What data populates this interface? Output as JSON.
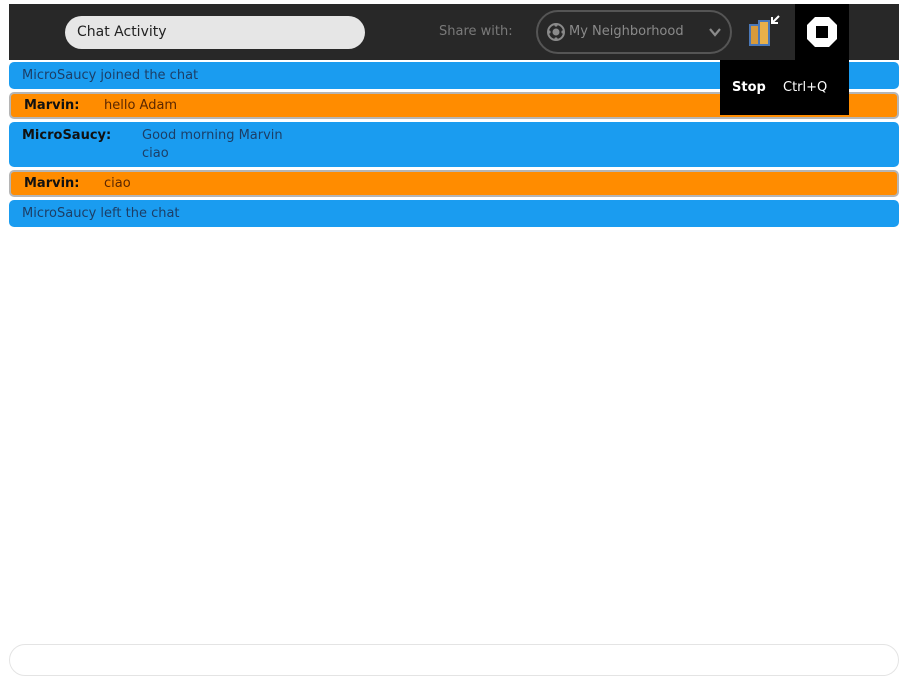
{
  "toolbar": {
    "activity_title": "Chat Activity",
    "share_label": "Share with:",
    "share_value": "My Neighborhood",
    "icons": [
      "neighborhood-icon",
      "chevron-down-icon",
      "keep-icon",
      "stop-icon"
    ]
  },
  "stop_palette": {
    "title": "Stop",
    "accelerator": "Ctrl+Q"
  },
  "messages": [
    {
      "type": "status",
      "text": "MicroSaucy joined the chat",
      "color": "#1a9cf0"
    },
    {
      "type": "chat",
      "nick": "Marvin:",
      "lines": [
        "hello Adam"
      ],
      "color": "#ff8c00"
    },
    {
      "type": "chat",
      "nick": "MicroSaucy:",
      "lines": [
        "Good morning Marvin",
        "ciao"
      ],
      "color": "#1a9cf0"
    },
    {
      "type": "chat",
      "nick": "Marvin:",
      "lines": [
        "ciao"
      ],
      "color": "#ff8c00"
    },
    {
      "type": "status",
      "text": "MicroSaucy left the chat",
      "color": "#1a9cf0"
    }
  ],
  "entry": {
    "value": "",
    "placeholder": ""
  },
  "colors": {
    "toolbar_bg": "#282828",
    "buddy_blue": "#1a9cf0",
    "buddy_orange": "#ff8c00"
  }
}
